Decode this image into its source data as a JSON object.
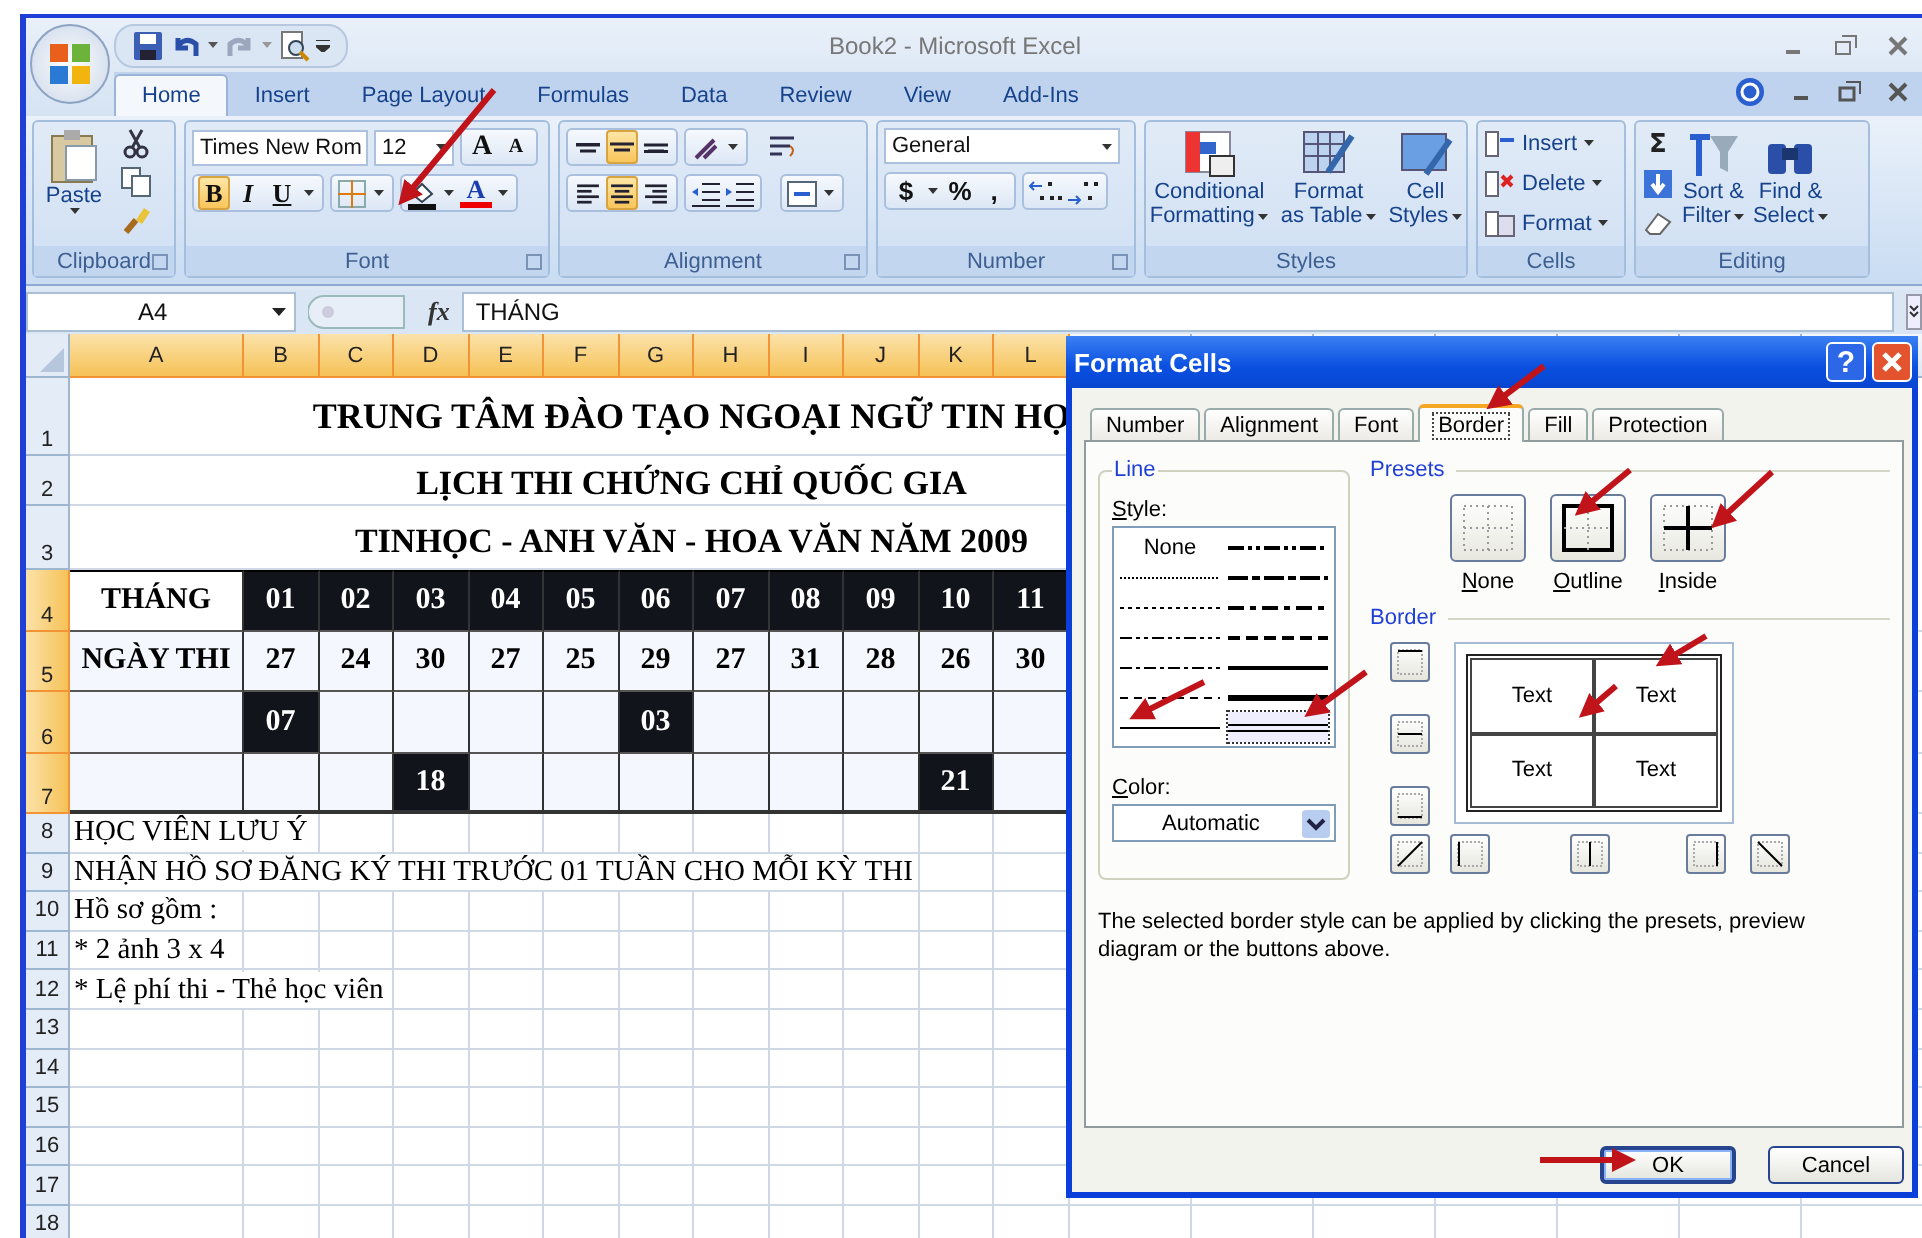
{
  "window": {
    "title": "Book2 - Microsoft Excel"
  },
  "ribbon_tabs": [
    {
      "label": "Home",
      "selected": true
    },
    {
      "label": "Insert",
      "selected": false
    },
    {
      "label": "Page Layout",
      "selected": false
    },
    {
      "label": "Formulas",
      "selected": false
    },
    {
      "label": "Data",
      "selected": false
    },
    {
      "label": "Review",
      "selected": false
    },
    {
      "label": "View",
      "selected": false
    },
    {
      "label": "Add-Ins",
      "selected": false
    }
  ],
  "clipboard": {
    "paste": "Paste",
    "label": "Clipboard"
  },
  "font": {
    "name": "Times New Rom",
    "size": "12",
    "grow": "A",
    "shrink": "A",
    "bold": {
      "glyph": "B",
      "on": true
    },
    "italic": {
      "glyph": "I",
      "on": false
    },
    "underline": {
      "glyph": "U",
      "on": false
    },
    "color_glyph": "A",
    "label": "Font"
  },
  "alignment": {
    "vertical": [
      {
        "kind": "top",
        "selected": false
      },
      {
        "kind": "middle",
        "selected": true
      },
      {
        "kind": "bottom",
        "selected": false
      }
    ],
    "horizontal": [
      {
        "kind": "left",
        "selected": false
      },
      {
        "kind": "center",
        "selected": true
      },
      {
        "kind": "right",
        "selected": false
      }
    ],
    "label": "Alignment"
  },
  "number": {
    "format": "General",
    "currency": "$",
    "percent": "%",
    "comma": ",",
    "label": "Number"
  },
  "styles": {
    "buttons": [
      {
        "line1": "Conditional",
        "line2": "Formatting"
      },
      {
        "line1": "Format",
        "line2": "as Table"
      },
      {
        "line1": "Cell",
        "line2": "Styles"
      }
    ],
    "label": "Styles"
  },
  "cells": {
    "buttons": [
      "Insert",
      "Delete",
      "Format"
    ],
    "label": "Cells"
  },
  "editing": {
    "sum": "Σ",
    "buttons": [
      {
        "line1": "Sort &",
        "line2": "Filter"
      },
      {
        "line1": "Find &",
        "line2": "Select"
      }
    ],
    "label": "Editing"
  },
  "formula_bar": {
    "name_box": "A4",
    "fx": "fx",
    "content": "THÁNG"
  },
  "sheet": {
    "columns": [
      {
        "label": "A",
        "selected": true
      },
      {
        "label": "B",
        "selected": true
      },
      {
        "label": "C",
        "selected": true
      },
      {
        "label": "D",
        "selected": true
      },
      {
        "label": "E",
        "selected": true
      },
      {
        "label": "F",
        "selected": true
      },
      {
        "label": "G",
        "selected": true
      },
      {
        "label": "H",
        "selected": true
      },
      {
        "label": "I",
        "selected": true
      },
      {
        "label": "J",
        "selected": true
      },
      {
        "label": "K",
        "selected": true
      },
      {
        "label": "L",
        "selected": true
      }
    ],
    "rows": [
      {
        "number": "1",
        "selected": false,
        "kind": "title",
        "text": "TRUNG TÂM ĐÀO TẠO NGOẠI NGỮ TIN HỌ"
      },
      {
        "number": "2",
        "selected": false,
        "kind": "subtitle",
        "text": "LỊCH THI CHỨNG CHỈ QUỐC GIA"
      },
      {
        "number": "3",
        "selected": false,
        "kind": "subtitle",
        "text": "TINHỌC - ANH VĂN - HOA VĂN NĂM 2009"
      },
      {
        "number": "4",
        "selected": true,
        "kind": "cells",
        "cells": [
          {
            "text": "THÁNG",
            "dark": false
          },
          {
            "text": "01",
            "dark": true
          },
          {
            "text": "02",
            "dark": true
          },
          {
            "text": "03",
            "dark": true
          },
          {
            "text": "04",
            "dark": true
          },
          {
            "text": "05",
            "dark": true
          },
          {
            "text": "06",
            "dark": true
          },
          {
            "text": "07",
            "dark": true
          },
          {
            "text": "08",
            "dark": true
          },
          {
            "text": "09",
            "dark": true
          },
          {
            "text": "10",
            "dark": true
          },
          {
            "text": "11",
            "dark": true
          }
        ]
      },
      {
        "number": "5",
        "selected": true,
        "kind": "cells",
        "cells": [
          {
            "text": "NGÀY THI",
            "dark": false
          },
          {
            "text": "27",
            "dark": false
          },
          {
            "text": "24",
            "dark": false
          },
          {
            "text": "30",
            "dark": false
          },
          {
            "text": "27",
            "dark": false
          },
          {
            "text": "25",
            "dark": false
          },
          {
            "text": "29",
            "dark": false
          },
          {
            "text": "27",
            "dark": false
          },
          {
            "text": "31",
            "dark": false
          },
          {
            "text": "28",
            "dark": false
          },
          {
            "text": "26",
            "dark": false
          },
          {
            "text": "30",
            "dark": false
          }
        ]
      },
      {
        "number": "6",
        "selected": true,
        "kind": "cells",
        "cells": [
          {
            "dark": false
          },
          {
            "text": "07",
            "dark": true
          },
          {
            "dark": false
          },
          {
            "dark": false
          },
          {
            "dark": false
          },
          {
            "dark": false
          },
          {
            "text": "03",
            "dark": true
          },
          {
            "dark": false
          },
          {
            "dark": false
          },
          {
            "dark": false
          },
          {
            "dark": false
          },
          {
            "dark": false
          }
        ]
      },
      {
        "number": "7",
        "selected": true,
        "kind": "cells",
        "cells": [
          {
            "dark": false
          },
          {
            "dark": false
          },
          {
            "dark": false
          },
          {
            "text": "18",
            "dark": true
          },
          {
            "dark": false
          },
          {
            "dark": false
          },
          {
            "dark": false
          },
          {
            "dark": false
          },
          {
            "dark": false
          },
          {
            "dark": false
          },
          {
            "text": "21",
            "dark": true
          },
          {
            "dark": false
          }
        ]
      },
      {
        "number": "8",
        "selected": false,
        "kind": "note",
        "text": "HỌC VIÊN LƯU Ý"
      },
      {
        "number": "9",
        "selected": false,
        "kind": "note",
        "text": "NHẬN HỒ SƠ ĐĂNG KÝ THI TRƯỚC 01 TUẦN CHO MỖI KỲ THI"
      },
      {
        "number": "10",
        "selected": false,
        "kind": "note",
        "text": "Hồ sơ gồm :"
      },
      {
        "number": "11",
        "selected": false,
        "kind": "note",
        "text": "* 2 ảnh 3 x 4"
      },
      {
        "number": "12",
        "selected": false,
        "kind": "note",
        "text": "* Lệ phí thi - Thẻ học viên"
      },
      {
        "number": "13",
        "selected": false,
        "kind": "blank"
      },
      {
        "number": "14",
        "selected": false,
        "kind": "blank"
      },
      {
        "number": "15",
        "selected": false,
        "kind": "blank"
      },
      {
        "number": "16",
        "selected": false,
        "kind": "blank"
      },
      {
        "number": "17",
        "selected": false,
        "kind": "blank"
      },
      {
        "number": "18",
        "selected": false,
        "kind": "blank"
      }
    ]
  },
  "dialog": {
    "title": "Format Cells",
    "help": "?",
    "tabs": [
      {
        "label": "Number",
        "selected": false
      },
      {
        "label": "Alignment",
        "selected": false
      },
      {
        "label": "Font",
        "selected": false
      },
      {
        "label": "Border",
        "selected": true
      },
      {
        "label": "Fill",
        "selected": false
      },
      {
        "label": "Protection",
        "selected": false
      }
    ],
    "line": {
      "label": "Line",
      "style_label": "Style:",
      "styles": [
        {
          "kind": "none",
          "label": "None",
          "selected": false
        },
        {
          "kind": "hair",
          "selected": false
        },
        {
          "kind": "dotted",
          "selected": false
        },
        {
          "kind": "dash_dot_dot",
          "selected": false
        },
        {
          "kind": "dash_dot",
          "selected": false
        },
        {
          "kind": "dashed",
          "selected": false
        },
        {
          "kind": "thin",
          "selected": false
        },
        {
          "kind": "medium_dash_dot_dot",
          "selected": false
        },
        {
          "kind": "slant_dash_dot",
          "selected": false
        },
        {
          "kind": "medium_dash_dot",
          "selected": false
        },
        {
          "kind": "medium_dashed",
          "selected": false
        },
        {
          "kind": "medium",
          "selected": false
        },
        {
          "kind": "thick",
          "selected": false
        },
        {
          "kind": "double",
          "selected": true
        }
      ],
      "color_label": "Color:",
      "color_choice": "Automatic"
    },
    "presets": {
      "label": "Presets",
      "items": [
        {
          "kind": "none",
          "label": "None"
        },
        {
          "kind": "outline",
          "label": "Outline"
        },
        {
          "kind": "inside",
          "label": "Inside"
        }
      ]
    },
    "border": {
      "label": "Border",
      "preview": [
        "Text",
        "Text",
        "Text",
        "Text"
      ]
    },
    "note": "The selected border style can be applied by clicking the presets, preview diagram or the buttons above.",
    "buttons": [
      {
        "label": "OK",
        "default": true
      },
      {
        "label": "Cancel",
        "default": false
      }
    ]
  }
}
